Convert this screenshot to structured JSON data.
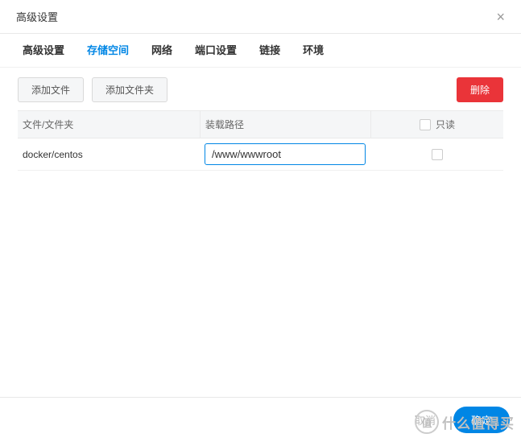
{
  "header": {
    "title": "高级设置"
  },
  "tabs": {
    "items": [
      {
        "label": "高级设置"
      },
      {
        "label": "存储空间"
      },
      {
        "label": "网络"
      },
      {
        "label": "端口设置"
      },
      {
        "label": "链接"
      },
      {
        "label": "环境"
      }
    ],
    "activeIndex": 1
  },
  "toolbar": {
    "add_file_label": "添加文件",
    "add_folder_label": "添加文件夹",
    "delete_label": "删除"
  },
  "table": {
    "header": {
      "file_folder": "文件/文件夹",
      "mount_path": "装载路径",
      "readonly": "只读"
    },
    "rows": [
      {
        "file_folder": "docker/centos",
        "mount_path": "/www/wwwroot",
        "readonly_checked": false
      }
    ]
  },
  "footer": {
    "cancel_label": "取消",
    "confirm_label": "确定"
  },
  "watermark": {
    "circle_text": "值",
    "text": "什么值得买"
  }
}
